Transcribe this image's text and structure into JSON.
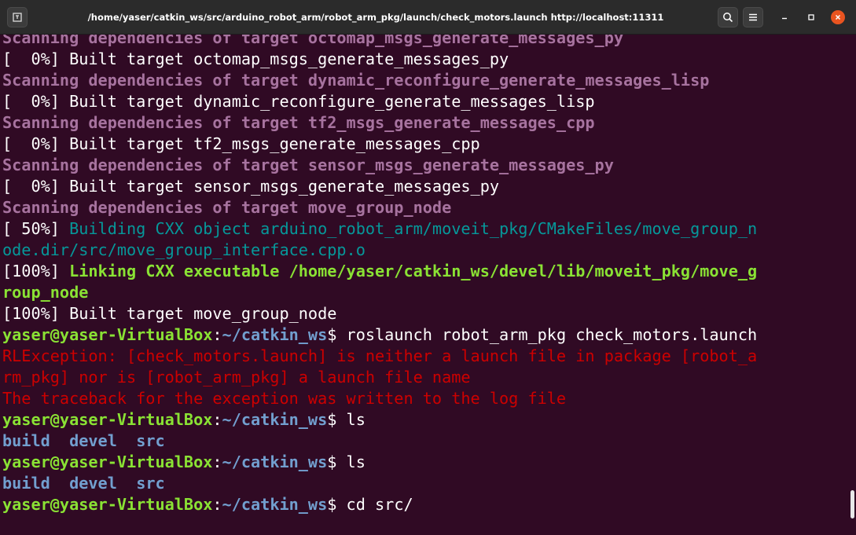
{
  "window": {
    "title": "/home/yaser/catkin_ws/src/arduino_robot_arm/robot_arm_pkg/launch/check_motors.launch http://localhost:11311",
    "icons": [
      "new-tab-icon",
      "search-icon",
      "menu-icon",
      "minimize-icon",
      "maximize-icon",
      "close-icon"
    ],
    "close_color": "#e95420"
  },
  "terminal": {
    "background": "#300a24",
    "lines": [
      [
        {
          "t": "Scanning dependencies of target octomap_msgs_generate_messages_py",
          "c": "dim"
        }
      ],
      [
        {
          "t": "[  0%] Built target octomap_msgs_generate_messages_py",
          "c": "white"
        }
      ],
      [
        {
          "t": "Scanning dependencies of target dynamic_reconfigure_generate_messages_lisp",
          "c": "dim"
        }
      ],
      [
        {
          "t": "[  0%] Built target dynamic_reconfigure_generate_messages_lisp",
          "c": "white"
        }
      ],
      [
        {
          "t": "Scanning dependencies of target tf2_msgs_generate_messages_cpp",
          "c": "dim"
        }
      ],
      [
        {
          "t": "[  0%] Built target tf2_msgs_generate_messages_cpp",
          "c": "white"
        }
      ],
      [
        {
          "t": "Scanning dependencies of target sensor_msgs_generate_messages_py",
          "c": "dim"
        }
      ],
      [
        {
          "t": "[  0%] Built target sensor_msgs_generate_messages_py",
          "c": "white"
        }
      ],
      [
        {
          "t": "Scanning dependencies of target move_group_node",
          "c": "dim"
        }
      ],
      [
        {
          "t": "[ 50%] ",
          "c": "white"
        },
        {
          "t": "Building CXX object arduino_robot_arm/moveit_pkg/CMakeFiles/move_group_n",
          "c": "green-n"
        }
      ],
      [
        {
          "t": "ode.dir/src/move_group_interface.cpp.o",
          "c": "green-n"
        }
      ],
      [
        {
          "t": "[100%] ",
          "c": "white"
        },
        {
          "t": "Linking CXX executable /home/yaser/catkin_ws/devel/lib/moveit_pkg/move_g",
          "c": "green"
        }
      ],
      [
        {
          "t": "roup_node",
          "c": "green"
        }
      ],
      [
        {
          "t": "[100%] Built target move_group_node",
          "c": "white"
        }
      ],
      [
        {
          "t": "yaser@yaser-VirtualBox",
          "c": "user"
        },
        {
          "t": ":",
          "c": "white"
        },
        {
          "t": "~/catkin_ws",
          "c": "path"
        },
        {
          "t": "$ roslaunch robot_arm_pkg check_motors.launch",
          "c": "white"
        }
      ],
      [
        {
          "t": "RLException: [check_motors.launch] is neither a launch file in package [robot_a",
          "c": "red"
        }
      ],
      [
        {
          "t": "rm_pkg] nor is [robot_arm_pkg] a launch file name",
          "c": "red"
        }
      ],
      [
        {
          "t": "The traceback for the exception was written to the log file",
          "c": "red"
        }
      ],
      [
        {
          "t": "yaser@yaser-VirtualBox",
          "c": "user"
        },
        {
          "t": ":",
          "c": "white"
        },
        {
          "t": "~/catkin_ws",
          "c": "path"
        },
        {
          "t": "$ ls",
          "c": "white"
        }
      ],
      [
        {
          "t": "build",
          "c": "dir"
        },
        {
          "t": "  ",
          "c": "white"
        },
        {
          "t": "devel",
          "c": "dir"
        },
        {
          "t": "  ",
          "c": "white"
        },
        {
          "t": "src",
          "c": "dir"
        }
      ],
      [
        {
          "t": "yaser@yaser-VirtualBox",
          "c": "user"
        },
        {
          "t": ":",
          "c": "white"
        },
        {
          "t": "~/catkin_ws",
          "c": "path"
        },
        {
          "t": "$ ls",
          "c": "white"
        }
      ],
      [
        {
          "t": "build",
          "c": "dir"
        },
        {
          "t": "  ",
          "c": "white"
        },
        {
          "t": "devel",
          "c": "dir"
        },
        {
          "t": "  ",
          "c": "white"
        },
        {
          "t": "src",
          "c": "dir"
        }
      ],
      [
        {
          "t": "yaser@yaser-VirtualBox",
          "c": "user"
        },
        {
          "t": ":",
          "c": "white"
        },
        {
          "t": "~/catkin_ws",
          "c": "path"
        },
        {
          "t": "$ cd src/",
          "c": "white"
        }
      ]
    ]
  }
}
